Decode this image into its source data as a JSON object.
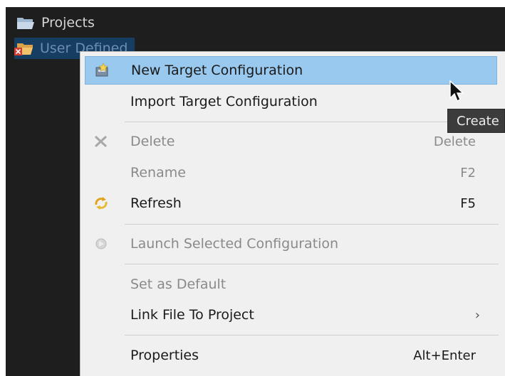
{
  "tree": {
    "projects_label": "Projects",
    "user_defined_label": "User Defined",
    "folder_icon": "folder-open-icon"
  },
  "menu": {
    "items": [
      {
        "label": "New Target Configuration",
        "shortcut": "",
        "icon": "new-target-config-icon",
        "enabled": true,
        "highlighted": true
      },
      {
        "label": "Import Target Configuration",
        "shortcut": "",
        "icon": "",
        "enabled": true,
        "highlighted": false
      },
      {
        "label": "Delete",
        "shortcut": "Delete",
        "icon": "delete-x-icon",
        "enabled": false,
        "highlighted": false
      },
      {
        "label": "Rename",
        "shortcut": "F2",
        "icon": "",
        "enabled": false,
        "highlighted": false
      },
      {
        "label": "Refresh",
        "shortcut": "F5",
        "icon": "refresh-icon",
        "enabled": true,
        "highlighted": false
      },
      {
        "label": "Launch Selected Configuration",
        "shortcut": "",
        "icon": "launch-icon",
        "enabled": false,
        "highlighted": false
      },
      {
        "label": "Set as Default",
        "shortcut": "",
        "icon": "",
        "enabled": false,
        "highlighted": false
      },
      {
        "label": "Link File To Project",
        "shortcut": "",
        "icon": "",
        "enabled": true,
        "highlighted": false,
        "submenu": true
      },
      {
        "label": "Properties",
        "shortcut": "Alt+Enter",
        "icon": "",
        "enabled": true,
        "highlighted": false
      }
    ]
  },
  "tooltip": {
    "text": "Create"
  },
  "colors": {
    "highlight": "#99c9ef",
    "menu_bg": "#f0f0f0",
    "tree_bg": "#1e1e1e",
    "disabled_text": "#8a8a8a"
  }
}
